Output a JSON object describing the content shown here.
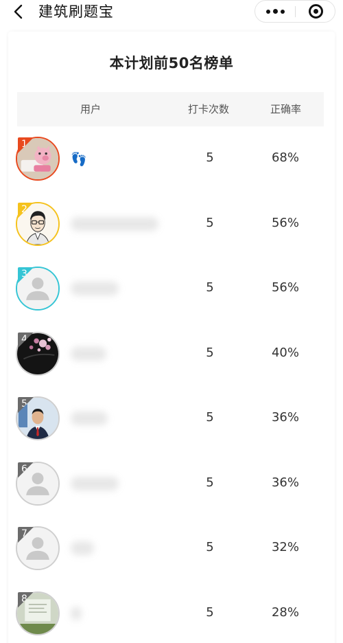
{
  "nav": {
    "title": "建筑刷题宝",
    "back_icon": "chevron-left-icon",
    "more_icon": "more-dots-icon",
    "close_icon": "target-close-icon"
  },
  "board": {
    "title": "本计划前50名榜单",
    "columns": {
      "user": "用户",
      "count": "打卡次数",
      "rate": "正确率"
    },
    "rank_colors": {
      "1": "#e8491e",
      "2": "#f5c21d",
      "3": "#35c5d5",
      "default": "#6b6b6b"
    },
    "rows": [
      {
        "rank": "1",
        "name": "👣",
        "count": "5",
        "rate": "68%",
        "avatar": "pig-avatar"
      },
      {
        "rank": "2",
        "name": "",
        "count": "5",
        "rate": "56%",
        "avatar": "cartoon-man-avatar"
      },
      {
        "rank": "3",
        "name": "",
        "count": "5",
        "rate": "56%",
        "avatar": "default-avatar"
      },
      {
        "rank": "4",
        "name": "",
        "count": "5",
        "rate": "40%",
        "avatar": "flower-avatar"
      },
      {
        "rank": "5",
        "name": "",
        "count": "5",
        "rate": "36%",
        "avatar": "photo-man-avatar"
      },
      {
        "rank": "6",
        "name": "",
        "count": "5",
        "rate": "36%",
        "avatar": "default-avatar"
      },
      {
        "rank": "7",
        "name": "",
        "count": "5",
        "rate": "32%",
        "avatar": "default-avatar"
      },
      {
        "rank": "8",
        "name": "",
        "count": "5",
        "rate": "28%",
        "avatar": "document-avatar"
      }
    ]
  }
}
